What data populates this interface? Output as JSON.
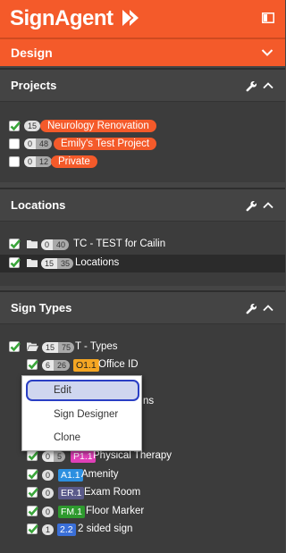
{
  "header": {
    "logo_text": "SignAgent",
    "design_label": "Design"
  },
  "sections": {
    "projects": {
      "title": "Projects"
    },
    "locations": {
      "title": "Locations"
    },
    "sign_types": {
      "title": "Sign Types"
    }
  },
  "projects": [
    {
      "checked": true,
      "count_a": "15",
      "count_b": "",
      "name": "Neurology Renovation"
    },
    {
      "checked": false,
      "count_a": "0",
      "count_b": "48",
      "name": "Emily's Test Project"
    },
    {
      "checked": false,
      "count_a": "0",
      "count_b": "12",
      "name": "Private"
    }
  ],
  "locations": [
    {
      "checked": true,
      "count_a": "0",
      "count_b": "40",
      "name": "TC - TEST for Cailin"
    },
    {
      "checked": true,
      "count_a": "15",
      "count_b": "35",
      "name": "Locations"
    }
  ],
  "sign_types": {
    "root": {
      "checked": true,
      "count_a": "15",
      "count_b": "75",
      "name": "T - Types"
    },
    "items": [
      {
        "checked": true,
        "count_a": "6",
        "count_b": "26",
        "code": "O1.1",
        "name": "Office ID",
        "code_bg": "#f5a623",
        "code_fg": "#1e1e1e"
      },
      {
        "checked": true,
        "count_a": "0",
        "count_b": "5",
        "code": "P1.1",
        "name": "Physical Therapy",
        "code_bg": "#e040b8",
        "code_fg": "#ffffff"
      },
      {
        "checked": true,
        "count_a": "0",
        "count_b": "",
        "code": "A1.1",
        "name": "Amenity",
        "code_bg": "#2c8fe0",
        "code_fg": "#ffffff"
      },
      {
        "checked": true,
        "count_a": "0",
        "count_b": "",
        "code": "ER.1",
        "name": "Exam Room",
        "code_bg": "#5a5a8a",
        "code_fg": "#ffffff"
      },
      {
        "checked": true,
        "count_a": "0",
        "count_b": "",
        "code": "FM.1",
        "name": "Floor Marker",
        "code_bg": "#2e9a2e",
        "code_fg": "#ffffff"
      },
      {
        "checked": true,
        "count_a": "1",
        "count_b": "",
        "code": "2.2",
        "name": "2 sided sign",
        "code_bg": "#3a6fd8",
        "code_fg": "#ffffff"
      }
    ],
    "hidden_text_fragment": "ns"
  },
  "context_menu": {
    "items": [
      "Edit",
      "Sign Designer",
      "Clone"
    ],
    "highlighted": "Edit"
  },
  "colors": {
    "brand": "#f45a2a",
    "panel": "#454545",
    "body": "#3c3c3c",
    "checkbox_green": "#3aa53a",
    "menu_highlight_border": "#2a3fc4"
  },
  "icons": {
    "logo": "play-arrow-mark",
    "panel": "sidebar-panel-icon",
    "design": "chevron-down-icon",
    "tools": "wrench-icon",
    "collapse": "chevron-up-icon",
    "folder": "folder-icon",
    "folder_open": "folder-open-icon",
    "check": "checkmark-icon"
  }
}
